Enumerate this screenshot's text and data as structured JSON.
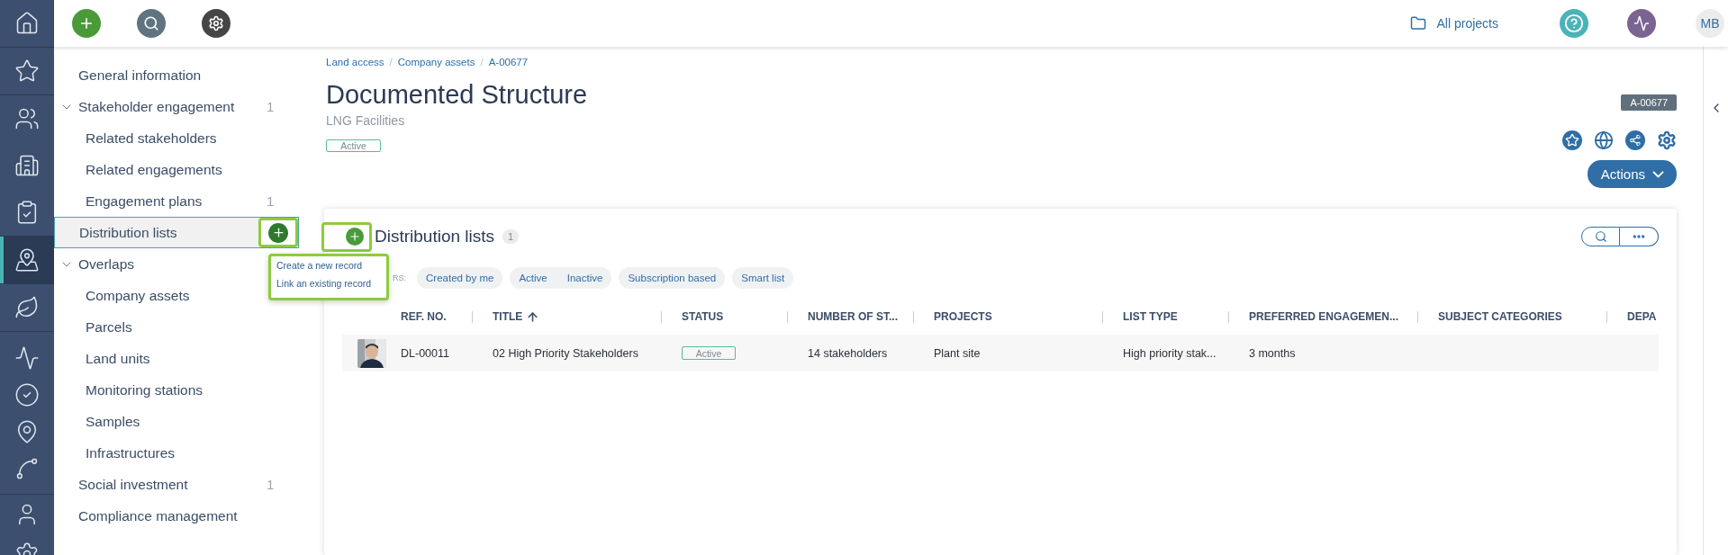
{
  "rail": {
    "groups": [
      {
        "items": [
          {
            "kind": "home",
            "selected": false
          }
        ]
      },
      {
        "items": [
          {
            "kind": "favorites",
            "selected": false
          }
        ]
      },
      {
        "items": [
          {
            "kind": "people",
            "selected": false
          },
          {
            "kind": "buildings",
            "selected": false
          },
          {
            "kind": "checklist",
            "selected": false
          }
        ]
      },
      {
        "items": [
          {
            "kind": "map",
            "selected": true
          }
        ]
      },
      {
        "items": [
          {
            "kind": "leaf",
            "selected": false
          }
        ]
      },
      {
        "items": [
          {
            "kind": "pulse",
            "selected": false
          },
          {
            "kind": "check",
            "selected": false
          },
          {
            "kind": "pin",
            "selected": false
          },
          {
            "kind": "chart",
            "selected": false
          }
        ]
      },
      {
        "items": [
          {
            "kind": "user",
            "selected": false
          },
          {
            "kind": "settings",
            "selected": false
          }
        ]
      }
    ]
  },
  "top_bar": {
    "actions": [
      {
        "kind": "add"
      },
      {
        "kind": "search"
      },
      {
        "kind": "settings"
      }
    ],
    "projects": "All projects",
    "user_initials": "MB"
  },
  "sidebar": {
    "items": [
      {
        "label": "General information",
        "selected": false
      },
      {
        "label": "Stakeholder engagement",
        "count": "1",
        "selected": false,
        "expanded": true,
        "children": [
          {
            "label": "Related stakeholders",
            "selected": false
          },
          {
            "label": "Related engagements",
            "selected": false
          },
          {
            "label": "Engagement plans",
            "count": "1",
            "selected": false
          }
        ]
      },
      {
        "label": "Distribution lists",
        "selected": true
      },
      {
        "label": "Overlaps",
        "selected": false,
        "expanded": true,
        "children": [
          {
            "label": "Company assets",
            "selected": false
          },
          {
            "label": "Parcels",
            "selected": false
          },
          {
            "label": "Land units",
            "selected": false
          },
          {
            "label": "Monitoring stations",
            "selected": false
          },
          {
            "label": "Samples",
            "selected": false
          },
          {
            "label": "Infrastructures",
            "selected": false
          }
        ]
      },
      {
        "label": "Social investment",
        "count": "1",
        "selected": false
      },
      {
        "label": "Compliance management",
        "selected": false
      }
    ]
  },
  "popup_menu": {
    "items": [
      "Create a new record",
      "Link an existing record"
    ]
  },
  "record": {
    "breadcrumb": [
      "Land access",
      "Company assets",
      "A-00677"
    ],
    "breadcrumb_separator": "/",
    "title": "Documented Structure",
    "subtitle": "LNG Facilities",
    "status": "Active",
    "id_badge": "A-00677",
    "actions_label": "Actions"
  },
  "card": {
    "title": "Distribution lists",
    "count": "1",
    "filter_label": "RS:",
    "filters": [
      {
        "options": [
          "Created by me"
        ]
      },
      {
        "options": [
          "Active",
          "Inactive"
        ]
      },
      {
        "options": [
          "Subscription based"
        ]
      },
      {
        "options": [
          "Smart list"
        ]
      }
    ],
    "columns": [
      {
        "label": "REF. NO.",
        "sorted": false
      },
      {
        "label": "TITLE",
        "sorted": true
      },
      {
        "label": "STATUS",
        "sorted": false
      },
      {
        "label": "NUMBER OF ST...",
        "sorted": false
      },
      {
        "label": "PROJECTS",
        "sorted": false
      },
      {
        "label": "LIST TYPE",
        "sorted": false
      },
      {
        "label": "PREFERRED ENGAGEMEN...",
        "sorted": false
      },
      {
        "label": "SUBJECT CATEGORIES",
        "sorted": false
      },
      {
        "label": "DEPA",
        "sorted": false
      }
    ],
    "rows": [
      {
        "cells": [
          {
            "kind": "text",
            "text": "DL-00011"
          },
          {
            "kind": "text",
            "text": "02 High Priority Stakeholders"
          },
          {
            "kind": "status",
            "text": "Active"
          },
          {
            "kind": "text",
            "text": "14 stakeholders"
          },
          {
            "kind": "text",
            "text": "Plant site"
          },
          {
            "kind": "text",
            "text": "High priority stak..."
          },
          {
            "kind": "text",
            "text": "3 months"
          }
        ]
      }
    ]
  }
}
